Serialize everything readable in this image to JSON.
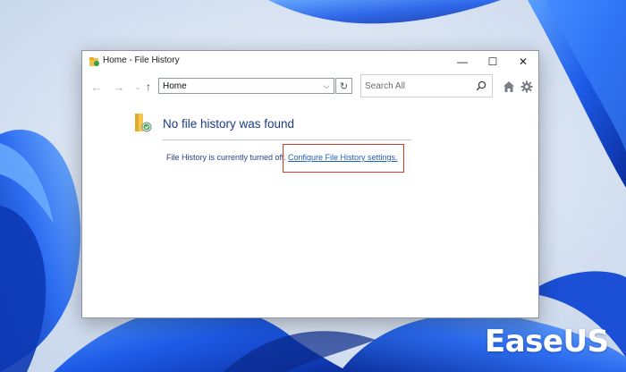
{
  "window": {
    "title": "Home - File History",
    "controls": {
      "minimize": "—",
      "maximize": "☐",
      "close": "✕"
    }
  },
  "toolbar": {
    "back_glyph": "←",
    "forward_glyph": "→",
    "recent_glyph": "⌄",
    "up_glyph": "↑",
    "address": "Home",
    "address_dropdown_glyph": "⌵",
    "refresh_glyph": "↻",
    "search_placeholder": "Search All"
  },
  "content": {
    "heading": "No file history was found",
    "status_text": "File History is currently turned off.",
    "link_text": "Configure File History settings."
  },
  "brand": {
    "logo_text": "EaseUS"
  },
  "icons": {
    "app": "file-history-icon",
    "home": "home-icon",
    "settings": "gear-icon",
    "search": "search-icon"
  },
  "colors": {
    "heading": "#1a3a8a",
    "link": "#1f5fbf",
    "highlight": "#d23c2a",
    "wallpaper": "#1f5fe0"
  }
}
